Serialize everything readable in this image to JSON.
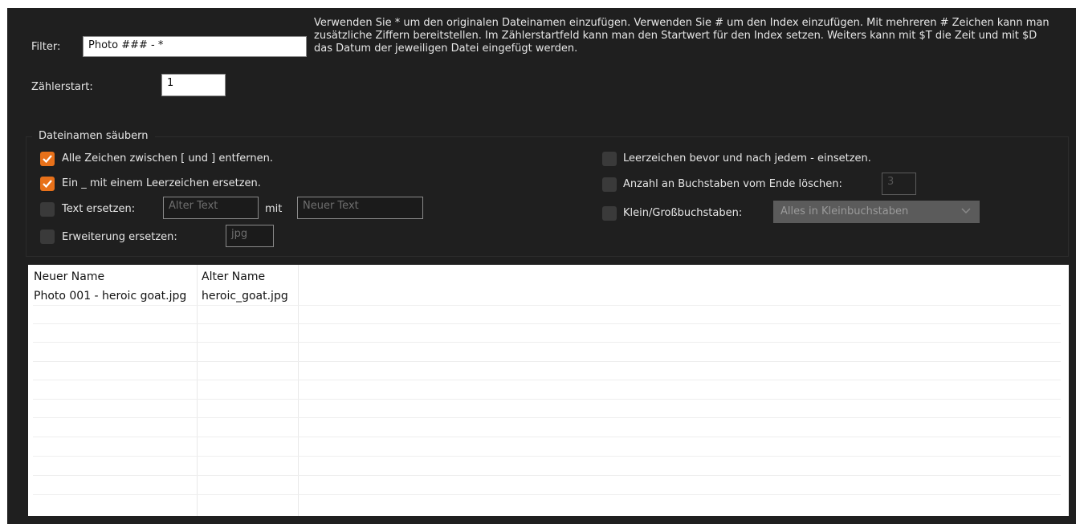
{
  "filter": {
    "label": "Filter:",
    "value": "Photo ### - *"
  },
  "counter": {
    "label": "Zählerstart:",
    "value": "1"
  },
  "help_text": "Verwenden Sie * um den originalen Dateinamen einzufügen. Verwenden Sie # um den Index einzufügen. Mit mehreren # Zeichen kann man zusätzliche Ziffern bereitstellen. Im Zählerstartfeld kann man den Startwert für den Index setzen. Weiters kann mit $T die Zeit und mit $D das Datum der jeweiligen Datei eingefügt werden.",
  "cleanup": {
    "title": "Dateinamen säubern",
    "remove_brackets": {
      "label": "Alle Zeichen zwischen [ und ] entfernen.",
      "checked": true
    },
    "replace_underscore": {
      "label": "Ein _ mit einem Leerzeichen ersetzen.",
      "checked": true
    },
    "replace_text": {
      "label": "Text ersetzen:",
      "checked": false,
      "old_placeholder": "Alter Text",
      "with_label": "mit",
      "new_placeholder": "Neuer Text"
    },
    "replace_extension": {
      "label": "Erweiterung ersetzen:",
      "checked": false,
      "value": "jpg"
    },
    "spaces_dash": {
      "label": "Leerzeichen bevor und nach jedem - einsetzen.",
      "checked": false
    },
    "delete_chars": {
      "label": "Anzahl an Buchstaben vom Ende löschen:",
      "checked": false,
      "value": "3"
    },
    "case": {
      "label": "Klein/Großbuchstaben:",
      "checked": false,
      "selected": "Alles in Kleinbuchstaben"
    }
  },
  "table": {
    "columns": [
      "Neuer Name",
      "Alter Name"
    ],
    "rows": [
      [
        "Photo 001 - heroic goat.jpg",
        "heroic_goat.jpg"
      ]
    ]
  },
  "colors": {
    "accent": "#e8711a",
    "background": "#1f1f1f"
  }
}
